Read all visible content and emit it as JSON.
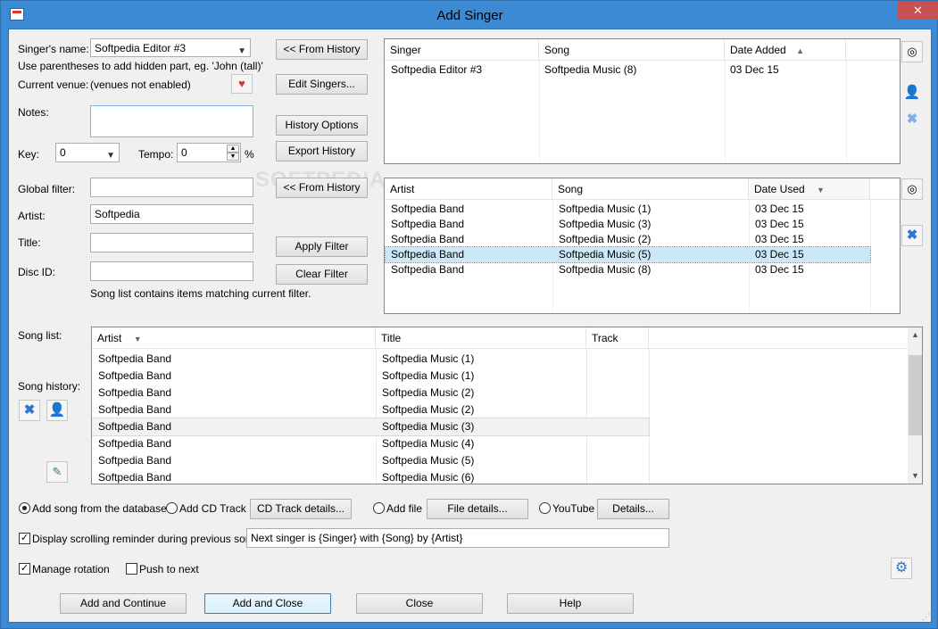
{
  "window": {
    "title": "Add Singer",
    "close_glyph": "✕"
  },
  "singer": {
    "name_label": "Singer's name:",
    "name_value": "Softpedia Editor #3",
    "hint": "Use parentheses to add hidden part, eg. 'John (tall)'",
    "venue_label": "Current venue:",
    "venue_value": "(venues not enabled)",
    "notes_label": "Notes:",
    "notes_value": "",
    "key_label": "Key:",
    "key_value": "0",
    "tempo_label": "Tempo:",
    "tempo_value": "0",
    "tempo_unit": "%"
  },
  "buttons": {
    "from_history_1": "<< From History",
    "edit_singers": "Edit Singers...",
    "history_options": "History Options",
    "export_history": "Export History",
    "from_history_2": "<< From History",
    "apply_filter": "Apply Filter",
    "clear_filter": "Clear Filter",
    "cd_track_details": "CD Track details...",
    "file_details": "File details...",
    "details": "Details...",
    "add_continue": "Add and Continue",
    "add_close": "Add and Close",
    "close": "Close",
    "help": "Help"
  },
  "filter": {
    "global_label": "Global filter:",
    "global_value": "",
    "artist_label": "Artist:",
    "artist_value": "Softpedia",
    "title_label": "Title:",
    "title_value": "",
    "disc_label": "Disc ID:",
    "disc_value": "",
    "status": "Song list contains items matching current filter."
  },
  "singer_history": {
    "headers": [
      "Singer",
      "Song",
      "Date Added"
    ],
    "rows": [
      [
        "Softpedia Editor #3",
        "Softpedia Music (8)",
        "03 Dec 15"
      ]
    ]
  },
  "song_history": {
    "headers": [
      "Artist",
      "Song",
      "Date Used"
    ],
    "rows": [
      [
        "Softpedia Band",
        "Softpedia Music (1)",
        "03 Dec 15"
      ],
      [
        "Softpedia Band",
        "Softpedia Music (3)",
        "03 Dec 15"
      ],
      [
        "Softpedia Band",
        "Softpedia Music (2)",
        "03 Dec 15"
      ],
      [
        "Softpedia Band",
        "Softpedia Music (5)",
        "03 Dec 15"
      ],
      [
        "Softpedia Band",
        "Softpedia Music (8)",
        "03 Dec 15"
      ]
    ],
    "selected_index": 3
  },
  "song_list": {
    "label": "Song list:",
    "history_label": "Song history:",
    "headers": [
      "Artist",
      "Title",
      "Track"
    ],
    "rows": [
      [
        "Softpedia Band",
        "Softpedia Music (1)",
        ""
      ],
      [
        "Softpedia Band",
        "Softpedia Music (1)",
        ""
      ],
      [
        "Softpedia Band",
        "Softpedia Music (2)",
        ""
      ],
      [
        "Softpedia Band",
        "Softpedia Music (2)",
        ""
      ],
      [
        "Softpedia Band",
        "Softpedia Music (3)",
        ""
      ],
      [
        "Softpedia Band",
        "Softpedia Music (4)",
        ""
      ],
      [
        "Softpedia Band",
        "Softpedia Music (5)",
        ""
      ],
      [
        "Softpedia Band",
        "Softpedia Music (6)",
        ""
      ]
    ],
    "selected_index": 4
  },
  "source": {
    "db_label": "Add song from the database",
    "cd_label": "Add CD Track",
    "file_label": "Add file",
    "youtube_label": "YouTube",
    "selected": "db"
  },
  "reminder": {
    "label": "Display scrolling reminder during previous song:",
    "checked": true,
    "value": "Next singer is {Singer} with {Song} by {Artist}"
  },
  "rotation": {
    "manage_label": "Manage rotation",
    "manage_checked": true,
    "push_label": "Push to next",
    "push_checked": false
  },
  "watermark": "SOFTPEDIA",
  "icons": {
    "venue": "venue-heart-icon",
    "glasses": "glasses-icon",
    "add_singer": "add-singer-icon",
    "delete": "delete-x-icon",
    "edit": "edit-note-icon",
    "settings": "settings-gear-icon",
    "sort_up": "sort-asc-icon",
    "sort_down": "sort-desc-icon"
  },
  "colors": {
    "title_bar": "#3c8ad4",
    "accent_blue": "#2b78d6",
    "selection": "#cbe8f6",
    "close_red": "#c75050"
  }
}
